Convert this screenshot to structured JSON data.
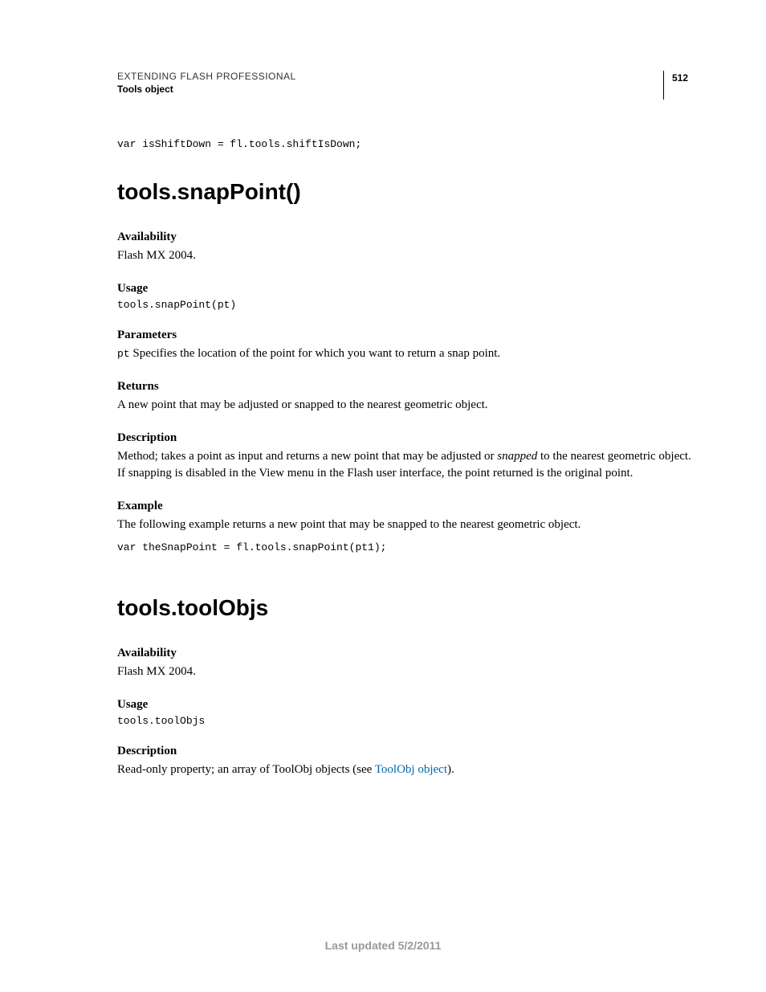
{
  "header": {
    "title": "EXTENDING FLASH PROFESSIONAL",
    "subtitle": "Tools object",
    "page_number": "512"
  },
  "top_code": "var isShiftDown = fl.tools.shiftIsDown;",
  "section1": {
    "title": "tools.snapPoint()",
    "availability_label": "Availability",
    "availability_text": "Flash MX 2004.",
    "usage_label": "Usage",
    "usage_code": "tools.snapPoint(pt)",
    "parameters_label": "Parameters",
    "param_name": "pt",
    "param_desc": "  Specifies the location of the point for which you want to return a snap point.",
    "returns_label": "Returns",
    "returns_text": "A new point that may be adjusted or snapped to the nearest geometric object.",
    "description_label": "Description",
    "description_text_pre": "Method; takes a point as input and returns a new point that may be adjusted or ",
    "description_text_em": "snapped",
    "description_text_post": " to the nearest geometric object. If snapping is disabled in the View menu in the Flash user interface, the point returned is the original point.",
    "example_label": "Example",
    "example_text": "The following example returns a new point that may be snapped to the nearest geometric object.",
    "example_code": "var theSnapPoint = fl.tools.snapPoint(pt1);"
  },
  "section2": {
    "title": "tools.toolObjs",
    "availability_label": "Availability",
    "availability_text": "Flash MX 2004.",
    "usage_label": "Usage",
    "usage_code": "tools.toolObjs",
    "description_label": "Description",
    "description_text_pre": "Read-only property; an array of ToolObj objects (see ",
    "description_link": "ToolObj object",
    "description_text_post": ")."
  },
  "footer": "Last updated 5/2/2011"
}
